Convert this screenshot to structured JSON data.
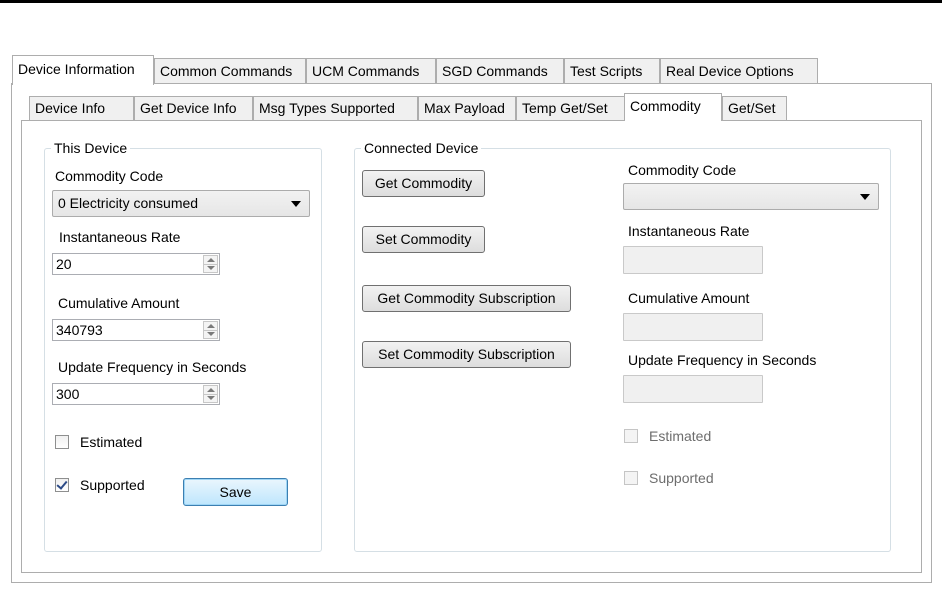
{
  "outer_tabs": [
    {
      "label": "Device Information",
      "active": true
    },
    {
      "label": "Common Commands",
      "active": false
    },
    {
      "label": "UCM Commands",
      "active": false
    },
    {
      "label": "SGD Commands",
      "active": false
    },
    {
      "label": "Test Scripts",
      "active": false
    },
    {
      "label": "Real Device Options",
      "active": false
    }
  ],
  "inner_tabs": [
    {
      "label": "Device Info",
      "active": false
    },
    {
      "label": "Get Device Info",
      "active": false
    },
    {
      "label": "Msg Types Supported",
      "active": false
    },
    {
      "label": "Max Payload",
      "active": false
    },
    {
      "label": "Temp Get/Set",
      "active": false
    },
    {
      "label": "Commodity",
      "active": true
    },
    {
      "label": "Get/Set",
      "active": false
    }
  ],
  "this_device": {
    "title": "This Device",
    "commodity_code_label": "Commodity Code",
    "commodity_code_value": "0 Electricity consumed",
    "instantaneous_rate_label": "Instantaneous Rate",
    "instantaneous_rate_value": "20",
    "cumulative_amount_label": "Cumulative Amount",
    "cumulative_amount_value": "340793",
    "update_frequency_label": "Update Frequency in Seconds",
    "update_frequency_value": "300",
    "estimated_label": "Estimated",
    "estimated_checked": false,
    "supported_label": "Supported",
    "supported_checked": true,
    "save_label": "Save"
  },
  "connected_device": {
    "title": "Connected Device",
    "get_commodity_label": "Get Commodity",
    "set_commodity_label": "Set Commodity",
    "get_subscription_label": "Get Commodity Subscription",
    "set_subscription_label": "Set Commodity Subscription",
    "commodity_code_label": "Commodity Code",
    "commodity_code_value": "",
    "instantaneous_rate_label": "Instantaneous Rate",
    "instantaneous_rate_value": "",
    "cumulative_amount_label": "Cumulative Amount",
    "cumulative_amount_value": "",
    "update_frequency_label": "Update Frequency in Seconds",
    "update_frequency_value": "",
    "estimated_label": "Estimated",
    "estimated_checked": false,
    "supported_label": "Supported",
    "supported_checked": false
  },
  "colors": {
    "tab_border": "#adadad",
    "group_border": "#d5dfe5",
    "default_button_border": "#3c7fb1",
    "disabled_text": "#6d6d6d"
  }
}
